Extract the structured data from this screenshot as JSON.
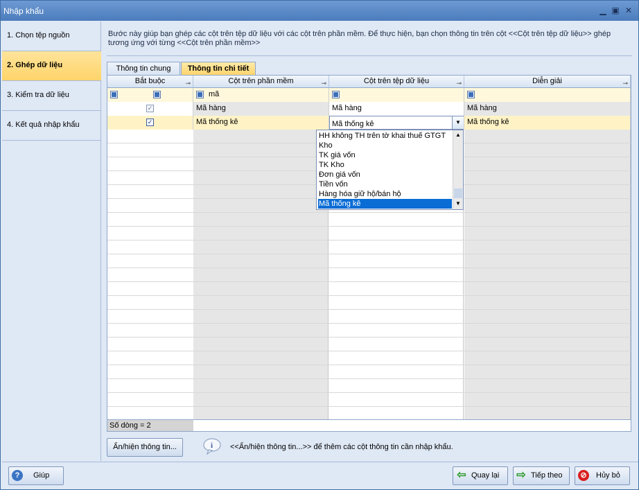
{
  "window": {
    "title": "Nhập khẩu"
  },
  "steps": [
    {
      "label": "1. Chọn tệp nguồn"
    },
    {
      "label": "2. Ghép dữ liệu"
    },
    {
      "label": "3. Kiểm tra dữ liệu"
    },
    {
      "label": "4. Kết quả nhập khẩu"
    }
  ],
  "description": "Bước này giúp bạn ghép các cột trên tệp dữ liệu với các cột trên phần mềm. Để thực hiện, bạn chọn thông tin trên cột <<Cột trên tệp dữ liệu>> ghép tương ứng với từng <<Cột trên phần mềm>>",
  "tabs": [
    {
      "label": "Thông tin chung"
    },
    {
      "label": "Thông tin chi tiết"
    }
  ],
  "grid": {
    "columns": [
      "Bắt buộc",
      "Cột trên phần mềm",
      "Cột trên tệp dữ liệu",
      "Diễn giải"
    ],
    "filter_text": "mã",
    "rows": [
      {
        "required": true,
        "software_col": "Mã hàng",
        "file_col": "Mã hàng",
        "note": "Mã hàng"
      },
      {
        "required": true,
        "software_col": "Mã thống kê",
        "file_col": "Mã thống kê",
        "note": "Mã thống kê"
      }
    ],
    "row_count": "Số dòng = 2"
  },
  "dropdown": {
    "items": [
      "HH không TH trên tờ khai thuế GTGT",
      "Kho",
      "TK giá vốn",
      "TK Kho",
      "Đơn giá vốn",
      "Tiền vốn",
      "Hàng hóa giữ hộ/bán hộ",
      "Mã thống kê"
    ],
    "selected": "Mã thống kê"
  },
  "info": {
    "button_label": "Ẩn/hiện thông tin...",
    "hint": "<<Ẩn/hiện thông tin...>> để thêm các cột thông tin cần nhập khẩu."
  },
  "buttons": {
    "help": "Giúp",
    "back": "Quay lại",
    "next": "Tiếp theo",
    "cancel": "Hủy bỏ"
  }
}
